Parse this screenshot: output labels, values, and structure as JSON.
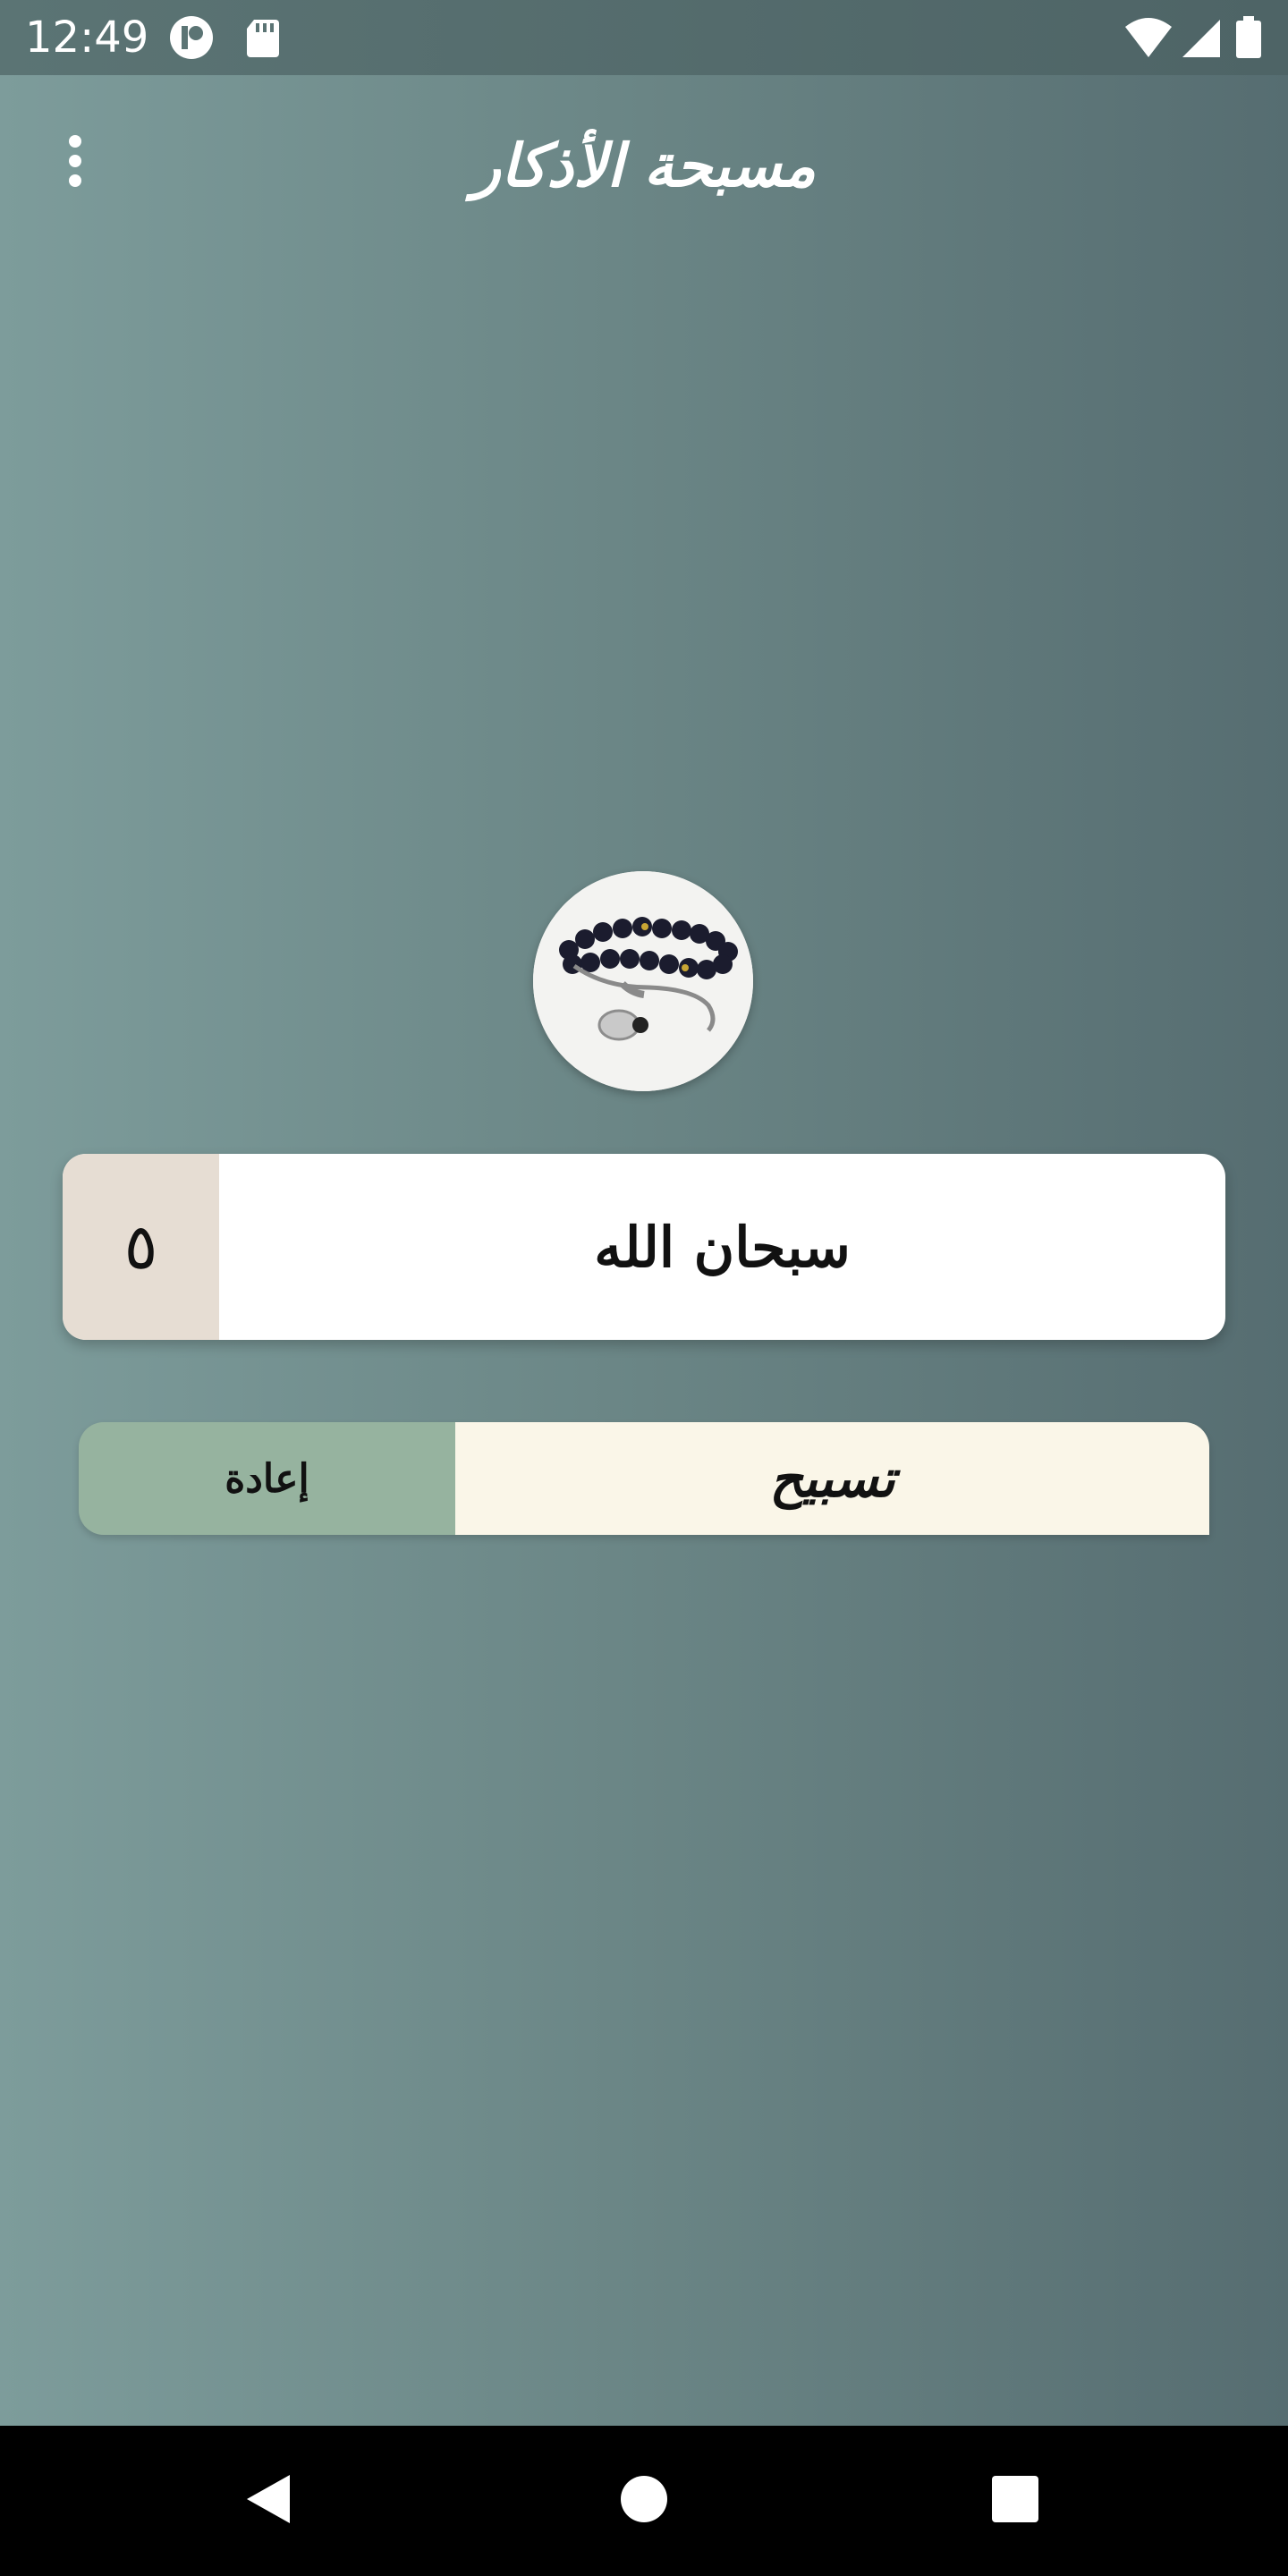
{
  "status_bar": {
    "time": "12:49",
    "icons": [
      "app-notification-icon",
      "sd-card-icon",
      "wifi-icon",
      "cell-signal-icon",
      "battery-icon"
    ]
  },
  "app_bar": {
    "title": "مسبحة الأذكار",
    "menu_icon": "more-vert-icon"
  },
  "beads_image": {
    "icon": "prayer-beads-image"
  },
  "dhikr": {
    "text": "سبحان الله",
    "count": "٥"
  },
  "actions": {
    "tasbih_label": "تسبيح",
    "reset_label": "إعادة"
  },
  "nav_bar": {
    "icons": [
      "back-icon",
      "home-icon",
      "recents-icon"
    ]
  },
  "colors": {
    "background_start": "#7d9c9b",
    "background_end": "#566d71",
    "count_box": "#e6ddd3",
    "reset_button": "#96b39f",
    "tasbih_button": "#faf6e8",
    "card": "#ffffff"
  }
}
